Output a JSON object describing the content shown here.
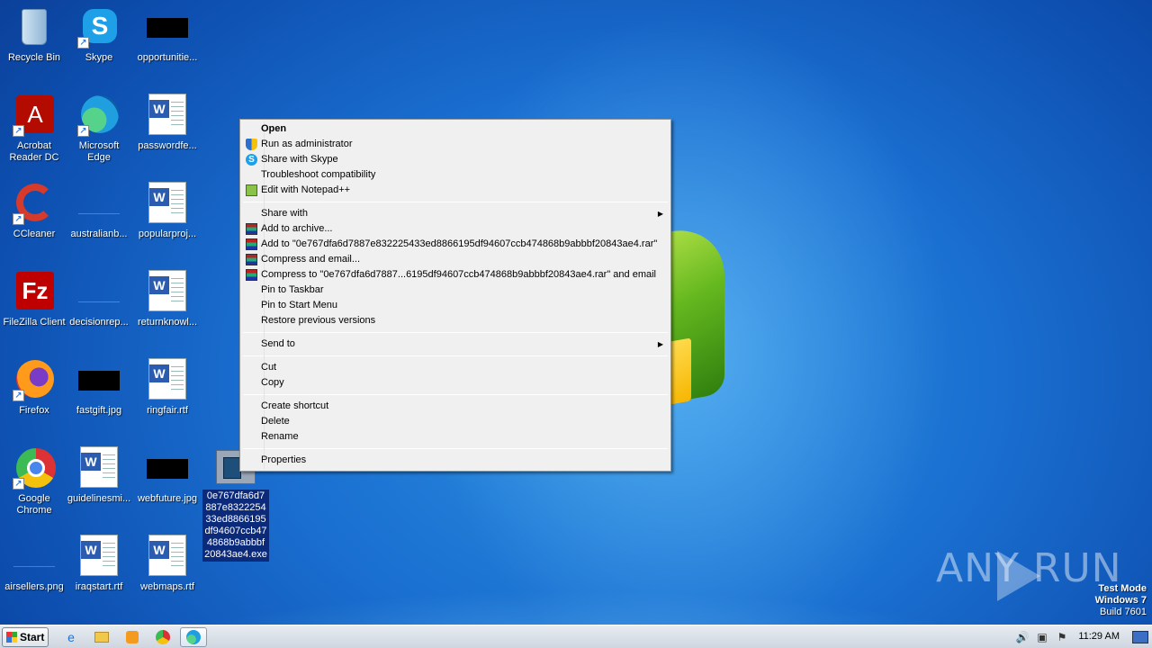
{
  "desktop": {
    "icons": [
      {
        "label": "Recycle Bin"
      },
      {
        "label": "Skype"
      },
      {
        "label": "opportunitie..."
      },
      {
        "label": "Acrobat Reader DC"
      },
      {
        "label": "Microsoft Edge"
      },
      {
        "label": "passwordfe..."
      },
      {
        "label": "CCleaner"
      },
      {
        "label": "australianb..."
      },
      {
        "label": "popularproj..."
      },
      {
        "label": "FileZilla Client"
      },
      {
        "label": "decisionrep..."
      },
      {
        "label": "returnknowl..."
      },
      {
        "label": "Firefox"
      },
      {
        "label": "fastgift.jpg"
      },
      {
        "label": "ringfair.rtf"
      },
      {
        "label": "Google Chrome"
      },
      {
        "label": "guidelinesmi..."
      },
      {
        "label": "webfuture.jpg"
      },
      {
        "label": "airsellers.png"
      },
      {
        "label": "iraqstart.rtf"
      },
      {
        "label": "webmaps.rtf"
      }
    ],
    "selected_file": {
      "label": "0e767dfa6d7887e832225433ed8866195df94607ccb474868b9abbbf20843ae4.exe"
    }
  },
  "context_menu": {
    "items": [
      {
        "label": "Open"
      },
      {
        "label": "Run as administrator"
      },
      {
        "label": "Share with Skype"
      },
      {
        "label": "Troubleshoot compatibility"
      },
      {
        "label": "Edit with Notepad++"
      },
      {
        "label": "Share with"
      },
      {
        "label": "Add to archive..."
      },
      {
        "label": "Add to \"0e767dfa6d7887e832225433ed8866195df94607ccb474868b9abbbf20843ae4.rar\""
      },
      {
        "label": "Compress and email..."
      },
      {
        "label": "Compress to \"0e767dfa6d7887...6195df94607ccb474868b9abbbf20843ae4.rar\" and email"
      },
      {
        "label": "Pin to Taskbar"
      },
      {
        "label": "Pin to Start Menu"
      },
      {
        "label": "Restore previous versions"
      },
      {
        "label": "Send to"
      },
      {
        "label": "Cut"
      },
      {
        "label": "Copy"
      },
      {
        "label": "Create shortcut"
      },
      {
        "label": "Delete"
      },
      {
        "label": "Rename"
      },
      {
        "label": "Properties"
      }
    ]
  },
  "watermark": {
    "text": "ANY RUN"
  },
  "system_info": {
    "line1": "Test Mode",
    "line2": "Windows 7",
    "line3": "Build 7601"
  },
  "taskbar": {
    "start_label": "Start",
    "clock": "11:29 AM"
  }
}
